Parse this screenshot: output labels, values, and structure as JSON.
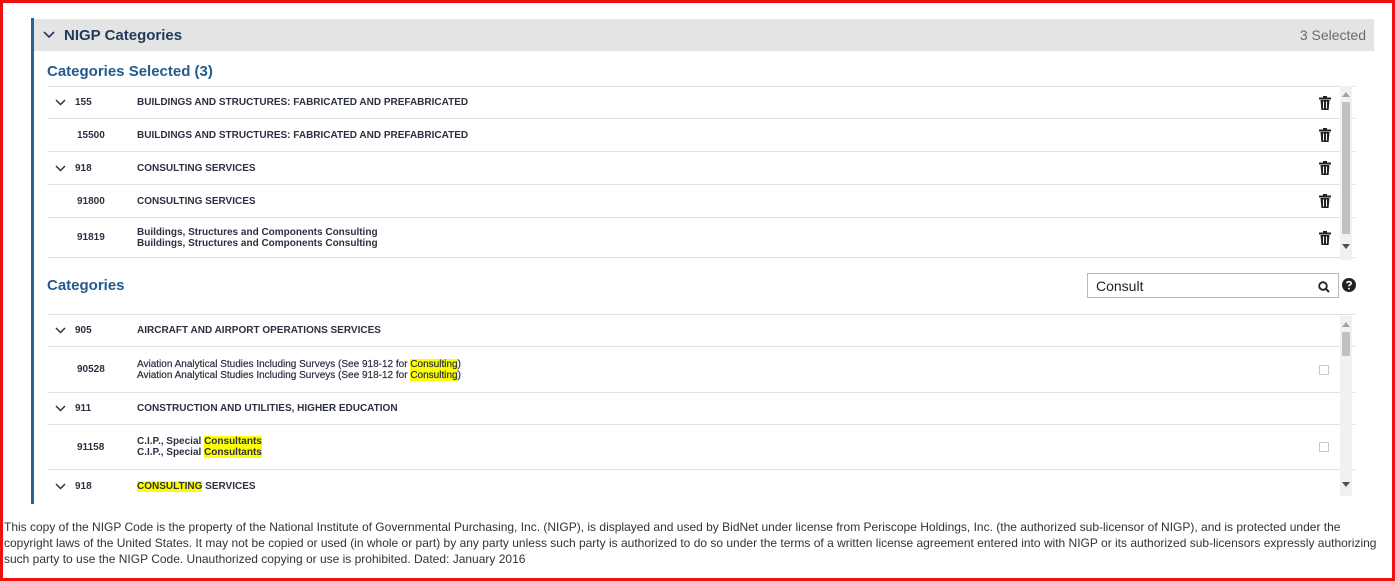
{
  "header": {
    "title": "NIGP Categories",
    "selected_count": "3 Selected"
  },
  "selected_section": {
    "title": "Categories Selected (3)",
    "rows": [
      {
        "code": "155",
        "label": "BUILDINGS AND STRUCTURES: FABRICATED AND PREFABRICATED",
        "parent": true
      },
      {
        "code": "15500",
        "label": "BUILDINGS AND STRUCTURES: FABRICATED AND PREFABRICATED",
        "parent": false
      },
      {
        "code": "918",
        "label": "CONSULTING SERVICES",
        "parent": true
      },
      {
        "code": "91800",
        "label": "CONSULTING SERVICES",
        "parent": false
      },
      {
        "code": "91819",
        "label": "Buildings, Structures and Components Consulting",
        "label2": "Buildings, Structures and Components Consulting",
        "parent": false
      }
    ]
  },
  "categories_section": {
    "title": "Categories",
    "search": {
      "value": "Consult",
      "placeholder": ""
    },
    "rows": [
      {
        "code": "905",
        "label": "AIRCRAFT AND AIRPORT OPERATIONS SERVICES",
        "parent": true
      },
      {
        "code": "90528",
        "label_pre": "Aviation Analytical Studies Including Surveys (See 918-12 for ",
        "label_hl": "Consulting",
        "label_post": ")",
        "parent": false
      },
      {
        "code": "911",
        "label": "CONSTRUCTION AND UTILITIES, HIGHER EDUCATION",
        "parent": true
      },
      {
        "code": "91158",
        "label_pre": "C.I.P., Special ",
        "label_hl": "Consultants",
        "label_post": "",
        "parent": false
      },
      {
        "code": "918",
        "label_hl": "CONSULTING",
        "label_post": " SERVICES",
        "parent": true
      }
    ]
  },
  "footer": {
    "text": "This copy of the NIGP Code is the property of the National Institute of Governmental Purchasing, Inc. (NIGP), is displayed and used by BidNet under license from Periscope Holdings, Inc. (the authorized sub-licensor of NIGP), and is protected under the copyright laws of the United States. It may not be copied or used (in whole or part) by any party unless such party is authorized to do so under the terms of a written license agreement entered into with NIGP or its authorized sub-licensors expressly authorizing such party to use the NIGP Code. Unauthorized copying or use is prohibited. Dated: January 2016"
  },
  "icons": {
    "collapse": "chevron-down-icon",
    "delete": "trash-icon",
    "search": "search-icon",
    "help": "help-circle-icon"
  },
  "colors": {
    "accent": "#245b8c",
    "highlight": "#ffff00",
    "frame": "#ee1111"
  }
}
